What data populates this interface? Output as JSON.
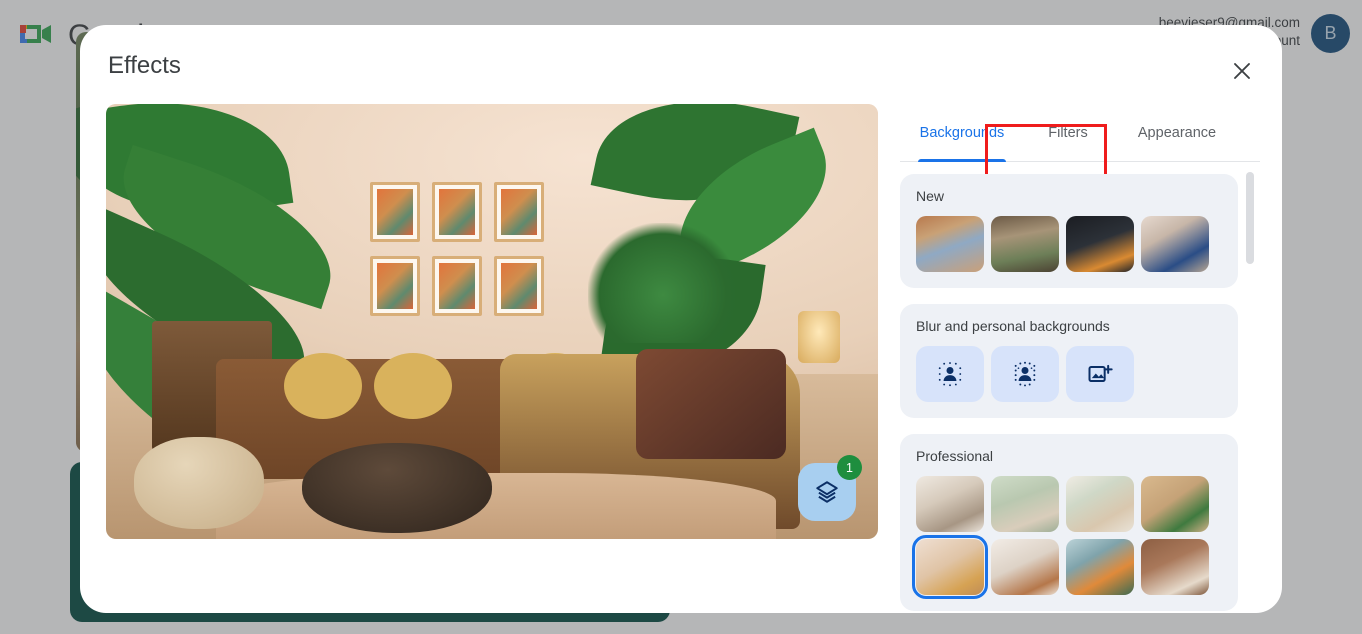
{
  "app": {
    "brand": "Google",
    "logo_icon": "google-meet-logo",
    "account_email": "beevieser9@gmail.com",
    "account_secondary": "Manage your Google Account",
    "avatar_initial": "B"
  },
  "dialog": {
    "title": "Effects",
    "close_icon": "close-icon"
  },
  "preview": {
    "fab_icon": "layers-icon",
    "fab_badge": "1"
  },
  "tabs": [
    {
      "label": "Backgrounds",
      "active": true
    },
    {
      "label": "Filters",
      "active": false
    },
    {
      "label": "Appearance",
      "active": false
    }
  ],
  "annotation": {
    "highlight_color": "#ef1c1c",
    "highlight_target": "Backgrounds"
  },
  "sections": [
    {
      "title": "New",
      "type": "thumbnails",
      "items": [
        {
          "name": "taj-mahal-terrace",
          "art": "a0"
        },
        {
          "name": "pergola-patio",
          "art": "a1"
        },
        {
          "name": "dark-room-fireplace",
          "art": "a2"
        },
        {
          "name": "blue-sofa-gallery-wall",
          "art": "a3"
        }
      ]
    },
    {
      "title": "Blur and personal backgrounds",
      "type": "blur",
      "items": [
        {
          "name": "slight-blur",
          "icon": "person-light-blur-icon"
        },
        {
          "name": "blur-background",
          "icon": "person-heavy-blur-icon"
        },
        {
          "name": "upload-image",
          "icon": "add-image-icon"
        }
      ]
    },
    {
      "title": "Professional",
      "type": "thumbnails",
      "items": [
        {
          "name": "white-bookshelf",
          "art": "b0",
          "selected": false
        },
        {
          "name": "green-wall-lounge",
          "art": "b1",
          "selected": false
        },
        {
          "name": "shelf-with-plants",
          "art": "b2",
          "selected": false
        },
        {
          "name": "wood-panel-plant",
          "art": "b3",
          "selected": false
        },
        {
          "name": "yellow-sofa-frames",
          "art": "c0",
          "selected": true
        },
        {
          "name": "desk-wall-art",
          "art": "c1",
          "selected": false
        },
        {
          "name": "pendant-lamps-office",
          "art": "c2",
          "selected": false
        },
        {
          "name": "brick-cafe-interior",
          "art": "c3",
          "selected": false
        }
      ]
    }
  ],
  "colors": {
    "accent": "#1a73e8",
    "badge_green": "#1e8e3e",
    "card_bg": "#eef1f6",
    "blur_btn_bg": "#d7e3fa",
    "scrim": "rgba(60,64,67,0.38)"
  },
  "scrollbar": {
    "name": "panel-scrollbar"
  }
}
